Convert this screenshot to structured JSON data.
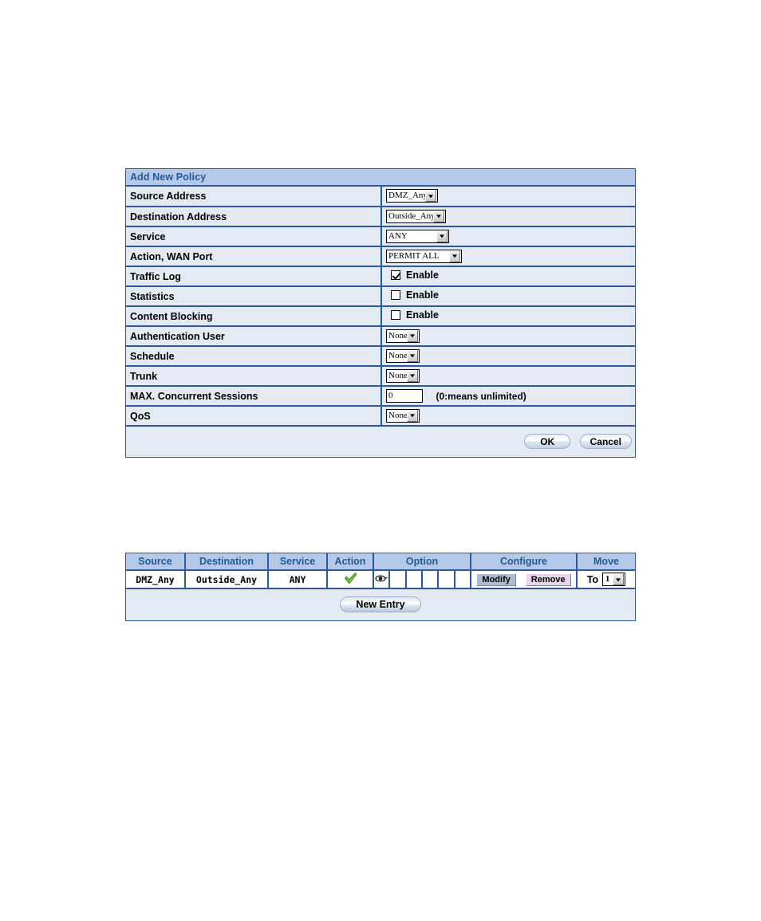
{
  "policy_form": {
    "title": "Add New Policy",
    "rows": [
      {
        "label": "Source Address",
        "control": "select",
        "value": "DMZ_Any",
        "width": "sel-w1"
      },
      {
        "label": "Destination Address",
        "control": "select",
        "value": "Outside_Any",
        "width": "sel-w2"
      },
      {
        "label": "Service",
        "control": "select",
        "value": "ANY",
        "width": "sel-w3"
      },
      {
        "label": "Action, WAN Port",
        "control": "select",
        "value": "PERMIT ALL",
        "width": "sel-w4"
      },
      {
        "label": "Traffic Log",
        "control": "checkbox",
        "value": "Enable",
        "checked": true
      },
      {
        "label": "Statistics",
        "control": "checkbox",
        "value": "Enable",
        "checked": false
      },
      {
        "label": "Content Blocking",
        "control": "checkbox",
        "value": "Enable",
        "checked": false
      },
      {
        "label": "Authentication User",
        "control": "select",
        "value": "None",
        "width": "sel-w5"
      },
      {
        "label": "Schedule",
        "control": "select",
        "value": "None",
        "width": "sel-w5"
      },
      {
        "label": "Trunk",
        "control": "select",
        "value": "None",
        "width": "sel-w5"
      },
      {
        "label": "MAX. Concurrent Sessions",
        "control": "text",
        "value": "0",
        "hint": "(0:means unlimited)"
      },
      {
        "label": "QoS",
        "control": "select",
        "value": "None",
        "width": "sel-w5"
      }
    ],
    "ok_label": "OK",
    "cancel_label": "Cancel"
  },
  "policy_list": {
    "headers": [
      "Source",
      "Destination",
      "Service",
      "Action",
      "Option",
      "Configure",
      "Move"
    ],
    "row": {
      "source": "DMZ_Any",
      "destination": "Outside_Any",
      "service": "ANY",
      "action_icon": "green-check-icon",
      "option_icons": [
        "eye-icon",
        "",
        "",
        "",
        "",
        ""
      ],
      "modify_label": "Modify",
      "remove_label": "Remove",
      "move_label": "To",
      "move_value": "1"
    },
    "new_entry_label": "New Entry"
  },
  "colors": {
    "panel_border": "#2b57a4",
    "header_bg": "#b6c8e8",
    "header_text": "#1c5c96",
    "row_bg": "#e4eaf3",
    "action_green": "#6dbf2e",
    "remove_pink": "#e9d4ec",
    "modify_blue": "#aebdd1"
  }
}
